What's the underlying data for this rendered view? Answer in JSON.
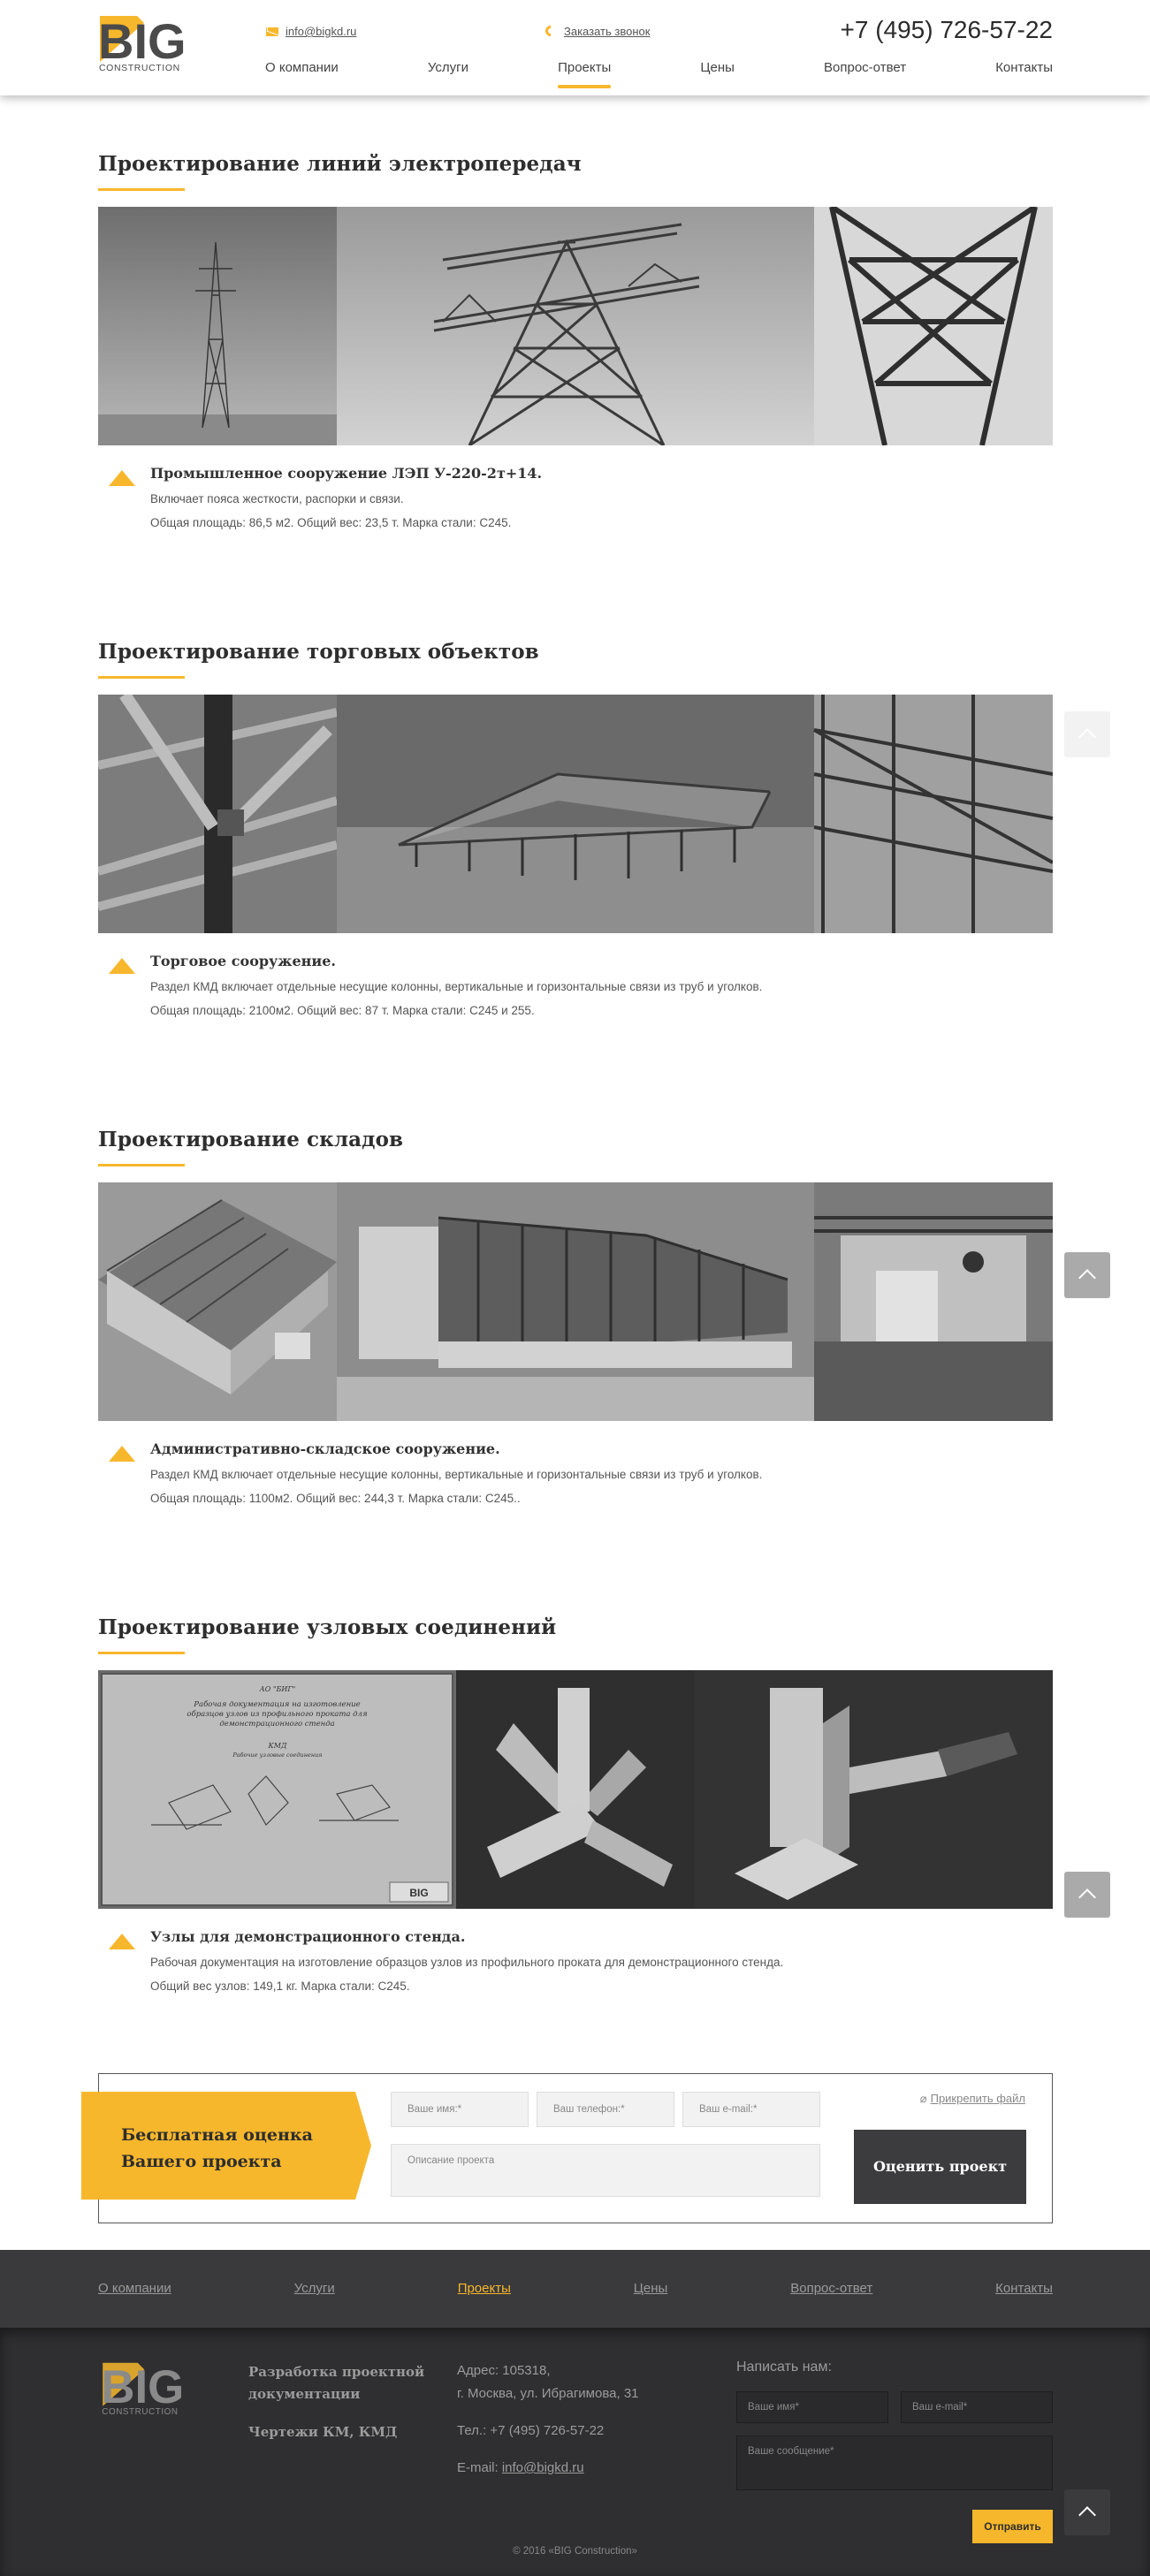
{
  "header": {
    "email": "info@bigkd.ru",
    "callback": "Заказать звонок",
    "phone": "+7 (495) 726-57-22",
    "nav": [
      "О компании",
      "Услуги",
      "Проекты",
      "Цены",
      "Вопрос-ответ",
      "Контакты"
    ],
    "active_nav": "Проекты"
  },
  "logo": {
    "big": "BIG",
    "sub": "CONSTRUCTION"
  },
  "colors": {
    "accent": "#f7b72c",
    "dark": "#3a3a3c",
    "footer": "#2f2f31"
  },
  "sections": [
    {
      "title": "Проектирование линий электропередач",
      "item_title": "Промышленное сооружение ЛЭП У-220-2т+14.",
      "line1": "Включает пояса жесткости, распорки и связи.",
      "line2": "Общая площадь: 86,5 м2. Общий вес: 23,5 т. Марка стали: С245."
    },
    {
      "title": "Проектирование торговых объектов",
      "item_title": "Торговое сооружение.",
      "line1": "Раздел КМД включает отдельные несущие колонны, вертикальные и горизонтальные связи из труб и уголков.",
      "line2": "Общая площадь: 2100м2. Общий вес: 87 т. Марка стали: С245 и 255."
    },
    {
      "title": "Проектирование складов",
      "item_title": "Административно-складское сооружение.",
      "line1": "Раздел КМД включает отдельные несущие колонны, вертикальные и горизонтальные связи из труб и уголков.",
      "line2": "Общая площадь: 1100м2. Общий вес: 244,3 т. Марка стали: С245.."
    },
    {
      "title": "Проектирование узловых соединений",
      "item_title": "Узлы для демонстрационного стенда.",
      "line1": "Рабочая документация на изготовление образцов узлов из профильного проката для демонстрационного стенда.",
      "line2": "Общий вес узлов: 149,1 кг. Марка стали: С245."
    }
  ],
  "drawing": {
    "title_top": "АО \"БИГ\"",
    "caption": "Рабочая документация на изготовление образцов узлов из профильного проката для демонстрационного стенда",
    "kmd": "КМД",
    "sheet": "Рабочие узловые соединения",
    "stamp": "BIG"
  },
  "estimate": {
    "badge": "Бесплатная оценка\nВашего проекта",
    "name_ph": "Ваше имя:*",
    "phone_ph": "Ваш телефон:*",
    "email_ph": "Ваш e-mail:*",
    "desc_ph": "Описание проекта",
    "attach": "Прикрепить файл",
    "button": "Оценить проект"
  },
  "footer": {
    "nav": [
      "О компании",
      "Услуги",
      "Проекты",
      "Цены",
      "Вопрос-ответ",
      "Контакты"
    ],
    "service1": "Разработка проектной документации",
    "service2": "Чертежи КМ, КМД",
    "addr1": "Адрес: 105318,",
    "addr2": "г. Москва, ул. Ибрагимова, 31",
    "tel": "Тел.: +7 (495) 726-57-22",
    "email_label": "E-mail: ",
    "email": "info@bigkd.ru",
    "write_us": "Написать нам:",
    "name_ph": "Ваше имя*",
    "email_ph": "Ваш e-mail*",
    "msg_ph": "Ваше сообщение*",
    "send": "Отправить",
    "copyright": "© 2016 «BIG Construction»"
  }
}
